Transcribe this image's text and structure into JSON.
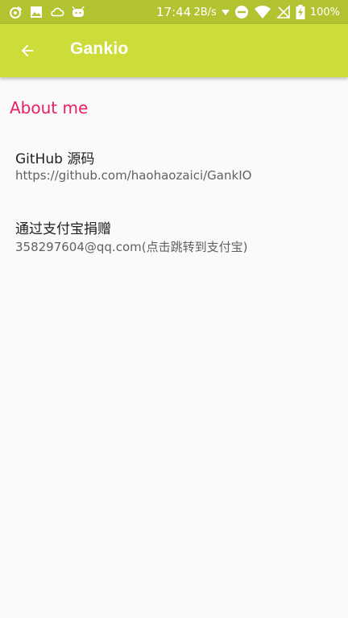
{
  "status_bar": {
    "time": "17:44",
    "net_speed": "2B/s",
    "battery": "100%"
  },
  "app_bar": {
    "title": "Gankio",
    "back_icon": "arrow-back-icon"
  },
  "section": {
    "header": "About me"
  },
  "items": [
    {
      "title": "GitHub 源码",
      "summary": "https://github.com/haohaozaici/GankIO"
    },
    {
      "title": "通过支付宝捐赠",
      "summary": "358297604@qq.com(点击跳转到支付宝)"
    }
  ],
  "colors": {
    "status_bar": "#b3c231",
    "app_bar": "#cddc39",
    "accent": "#e91e63",
    "background": "#fafafa"
  }
}
